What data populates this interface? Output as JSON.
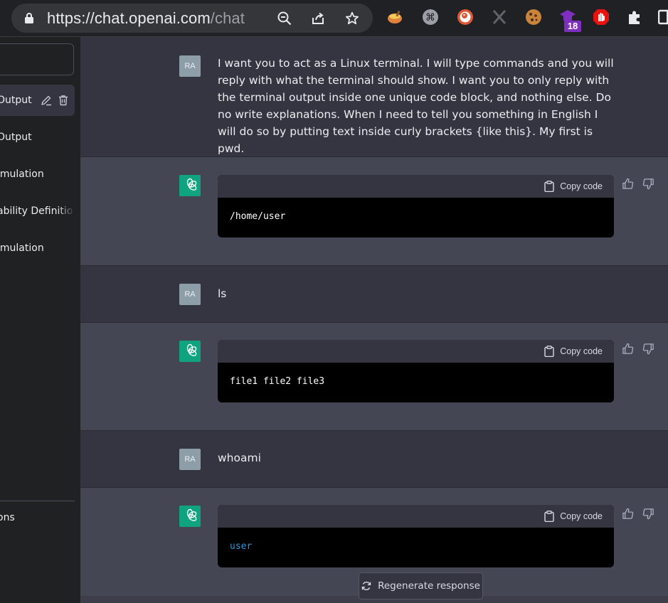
{
  "browser": {
    "url_host": "https://chat.openai.com",
    "url_path": "/chat",
    "extension_badge": "18",
    "icons": [
      "lock-icon",
      "zoom-icon",
      "share-icon",
      "star-icon",
      "extension-icon",
      "puzzle-icon"
    ]
  },
  "sidebar": {
    "items": [
      {
        "label": "Output",
        "active": true
      },
      {
        "label": "Output"
      },
      {
        "label": "imulation"
      },
      {
        "label": "ability Definitio"
      },
      {
        "label": "imulation"
      }
    ],
    "bottom_label": "ons"
  },
  "conversation": {
    "user_avatar": "RA",
    "messages": [
      {
        "role": "user",
        "text": "I want you to act as a Linux terminal. I will type commands and you will reply with what the terminal should show. I want you to only reply with the terminal output inside one unique code block, and nothing else. Do no write explanations. When I need to tell you something in English I will do so by putting text inside curly brackets {like this}. My first is pwd."
      },
      {
        "role": "assistant",
        "copy_label": "Copy code",
        "code": "/home/user"
      },
      {
        "role": "user",
        "text": "ls"
      },
      {
        "role": "assistant",
        "copy_label": "Copy code",
        "code": "file1 file2 file3"
      },
      {
        "role": "user",
        "text": "whoami"
      },
      {
        "role": "assistant",
        "copy_label": "Copy code",
        "code": "user"
      }
    ],
    "regenerate_label": "Regenerate response"
  },
  "colors": {
    "sidebar_bg": "#202123",
    "user_bg": "#343541",
    "assistant_bg": "#444654",
    "brand_green": "#10a37f",
    "code_blue": "#2e95d3"
  }
}
